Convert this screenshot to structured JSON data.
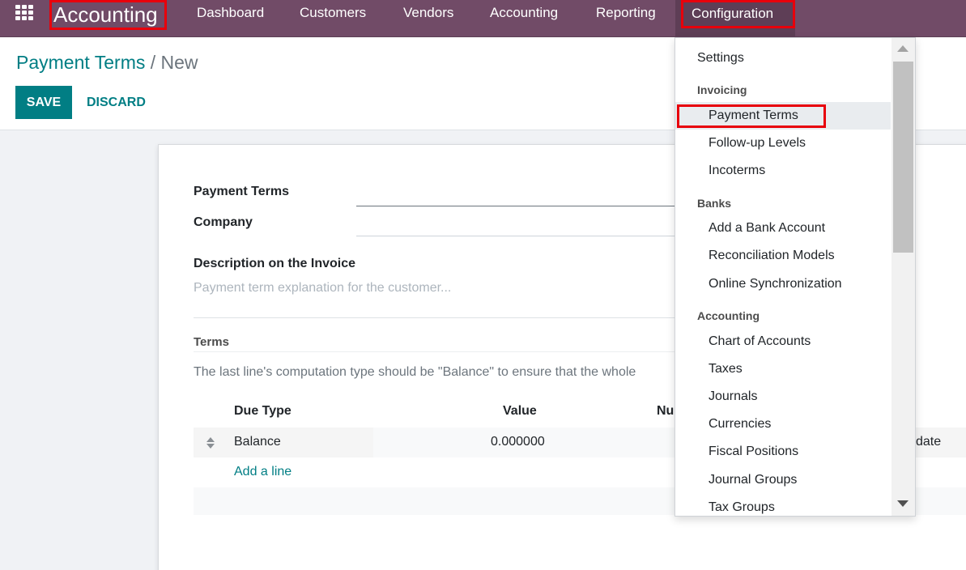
{
  "navbar": {
    "apps_icon": "grid-icon",
    "brand": "Accounting",
    "items": [
      "Dashboard",
      "Customers",
      "Vendors",
      "Accounting",
      "Reporting"
    ],
    "active": "Configuration"
  },
  "breadcrumb": {
    "parent": "Payment Terms",
    "separator": "/",
    "current": "New"
  },
  "buttons": {
    "save": "SAVE",
    "discard": "DISCARD"
  },
  "form": {
    "payment_terms_label": "Payment Terms",
    "company_label": "Company",
    "description_label": "Description on the Invoice",
    "description_placeholder": "Payment term explanation for the customer...",
    "terms_tab": "Terms",
    "terms_help": "The last line's computation type should be \"Balance\" to ensure that the whole",
    "columns": {
      "due_type": "Due Type",
      "value": "Value",
      "number": "Nu",
      "date": "date"
    },
    "rows": [
      {
        "due_type": "Balance",
        "value": "0.000000"
      }
    ],
    "add_line": "Add a line"
  },
  "dropdown": {
    "settings": "Settings",
    "sections": [
      {
        "header": "Invoicing",
        "items": [
          "Payment Terms",
          "Follow-up Levels",
          "Incoterms"
        ]
      },
      {
        "header": "Banks",
        "items": [
          "Add a Bank Account",
          "Reconciliation Models",
          "Online Synchronization"
        ]
      },
      {
        "header": "Accounting",
        "items": [
          "Chart of Accounts",
          "Taxes",
          "Journals",
          "Currencies",
          "Fiscal Positions",
          "Journal Groups",
          "Tax Groups"
        ]
      }
    ],
    "highlighted": "Payment Terms"
  },
  "colors": {
    "navbar": "#714b67",
    "primary": "#017e84",
    "highlight": "#e8000b"
  }
}
